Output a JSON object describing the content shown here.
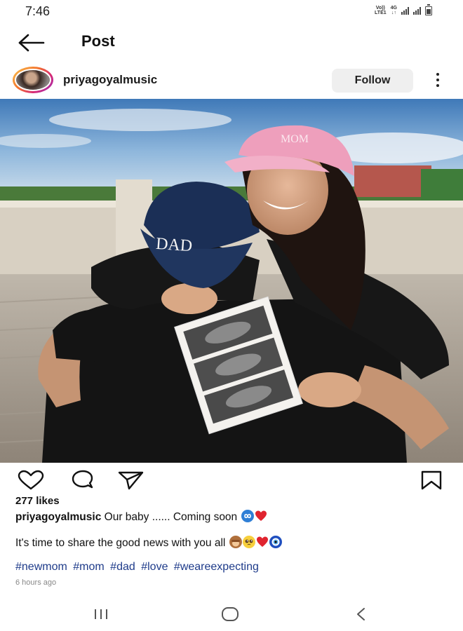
{
  "status_bar": {
    "time": "7:46",
    "network_label_top": "Vo))",
    "network_label_bottom": "LTE1",
    "network_type": "4G"
  },
  "header": {
    "title": "Post",
    "back_icon": "arrow-left-icon"
  },
  "profile": {
    "username": "priyagoyalmusic",
    "follow_label": "Follow",
    "more_icon": "more-vertical-icon"
  },
  "post": {
    "image_description_icon": "post-photo",
    "likes": "277 likes",
    "caption_user": "priyagoyalmusic",
    "caption_text": "Our baby ...... Coming soon",
    "caption_line2": "It's time to share the good news with you all",
    "hashtags": [
      "#newmom",
      "#mom",
      "#dad",
      "#love",
      "#weareexpecting"
    ],
    "time_ago": "6 hours ago"
  },
  "actions": {
    "like_icon": "heart-icon",
    "comment_icon": "comment-icon",
    "share_icon": "send-icon",
    "save_icon": "bookmark-icon"
  },
  "navbar": {
    "recent_icon": "recent-apps-icon",
    "home_icon": "home-icon",
    "back_icon": "back-chevron-icon"
  },
  "colors": {
    "hashtag": "#1e3b8a",
    "follow_bg": "#efefef",
    "text": "#111111"
  }
}
